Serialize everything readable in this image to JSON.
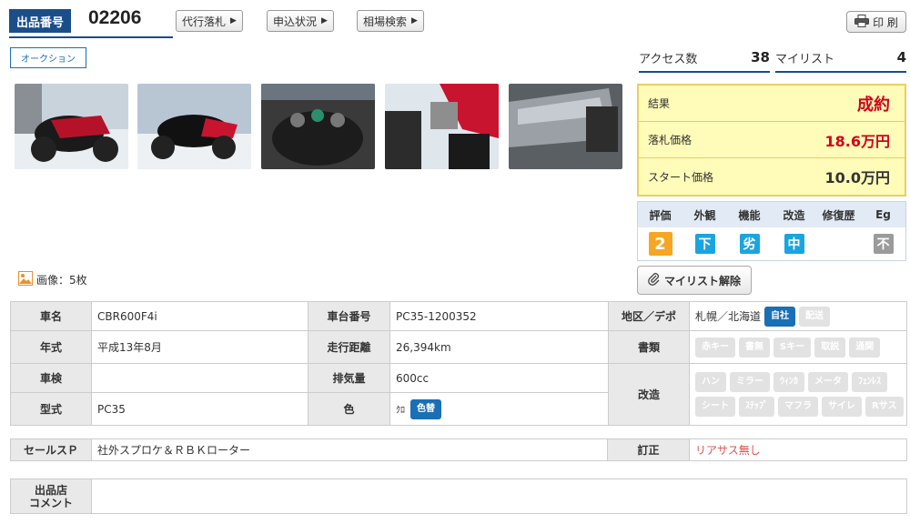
{
  "header": {
    "lot_label": "出品番号",
    "lot_number": "02206",
    "buttons": [
      "代行落札",
      "申込状況",
      "相場検索"
    ],
    "print_label": "印 刷"
  },
  "auction_tag": "オークション",
  "stats": {
    "access_label": "アクセス数",
    "access_value": "38",
    "mylist_label": "マイリスト",
    "mylist_value": "4"
  },
  "images": {
    "count_label": "画像：5枚"
  },
  "result": {
    "result_label": "結果",
    "result_value": "成約",
    "price_label": "落札価格",
    "price_value": "18.6万円",
    "start_label": "スタート価格",
    "start_value": "10.0万円"
  },
  "grade": {
    "headers": [
      "評価",
      "外観",
      "機能",
      "改造",
      "修復歴",
      "Eg"
    ],
    "values": [
      {
        "text": "2",
        "color": "#f5a623"
      },
      {
        "text": "下",
        "color": "#1aa5e0"
      },
      {
        "text": "劣",
        "color": "#1aa5e0"
      },
      {
        "text": "中",
        "color": "#1aa5e0"
      },
      {
        "text": "",
        "color": ""
      },
      {
        "text": "不",
        "color": "#9b9b9b"
      }
    ]
  },
  "mylist_button": "マイリスト解除",
  "spec": {
    "name_label": "車名",
    "name": "CBR600F4i",
    "frame_label": "車台番号",
    "frame": "PC35-1200352",
    "area_label": "地区／デポ",
    "area": "札幌／北海道",
    "area_tags": [
      {
        "text": "自社",
        "on": true
      },
      {
        "text": "配送",
        "on": false
      }
    ],
    "year_label": "年式",
    "year": "平成13年8月",
    "mileage_label": "走行距離",
    "mileage": "26,394km",
    "docs_label": "書類",
    "docs_tags": [
      "赤キー",
      "書無",
      "Sキー",
      "取説",
      "通関"
    ],
    "inspect_label": "車検",
    "inspect": "",
    "displacement_label": "排気量",
    "displacement": "600cc",
    "mod_label": "改造",
    "mod_tags_row1": [
      "ハン",
      "ミラー",
      "ｳｨﾝｶ",
      "メータ",
      "ﾌｪﾝﾚｽ"
    ],
    "mod_tags_row2": [
      "シート",
      "ｽﾃｯﾌﾟ",
      "マフラ",
      "サイレ",
      "Rサス"
    ],
    "model_label": "型式",
    "model": "PC35",
    "color_label": "色",
    "color": "ｸﾛ",
    "color_tag": "色替"
  },
  "sales": {
    "label": "セールスＰ",
    "value": "社外スプロケ＆ＲＢＫローター",
    "correction_label": "訂正",
    "correction_value": "リアサス無し"
  },
  "comment": {
    "label_line1": "出品店",
    "label_line2": "コメント",
    "value": ""
  }
}
